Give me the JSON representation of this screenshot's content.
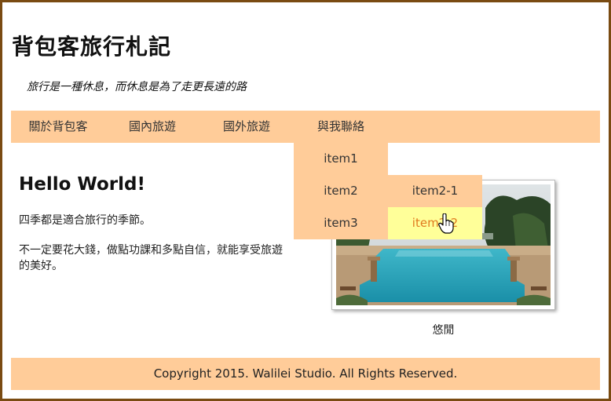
{
  "site": {
    "title": "背包客旅行札記",
    "tagline": "旅行是一種休息，而休息是為了走更長遠的路"
  },
  "nav": {
    "items": [
      {
        "label": "關於背包客"
      },
      {
        "label": "國內旅遊"
      },
      {
        "label": "國外旅遊"
      },
      {
        "label": "與我聯絡"
      }
    ]
  },
  "dropdown": {
    "items": [
      {
        "label": "item1"
      },
      {
        "label": "item2"
      },
      {
        "label": "item3"
      }
    ],
    "submenu": {
      "items": [
        {
          "label": "item2-1"
        },
        {
          "label": "item2-2"
        }
      ]
    }
  },
  "content": {
    "heading": "Hello World!",
    "p1": "四季都是適合旅行的季節。",
    "p2": "不一定要花大錢，做點功課和多點自信，就能享受旅遊的美好。"
  },
  "photo": {
    "caption": "悠閒"
  },
  "footer": {
    "copyright": "Copyright 2015. Walilei Studio. All Rights Reserved."
  },
  "colors": {
    "nav_bg": "#ffcc99",
    "hover_bg": "#ffff99",
    "hover_text": "#e07a1f",
    "frame_border": "#7a4b12"
  }
}
